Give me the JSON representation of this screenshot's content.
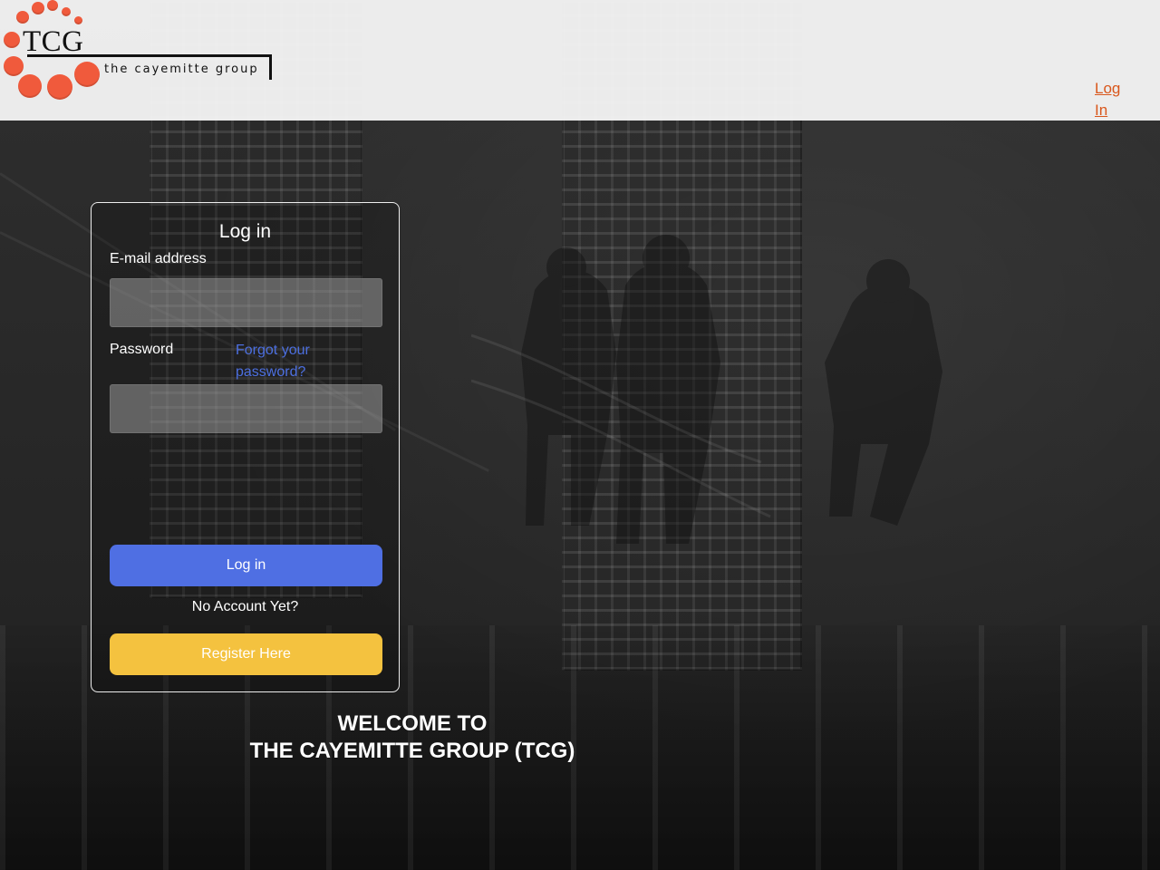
{
  "brand": {
    "logo_text": "TCG",
    "tagline": "the cayemitte group",
    "accent_color": "#f05a3c"
  },
  "header": {
    "login_link": "Log In",
    "login_link_color": "#d9571c"
  },
  "login_card": {
    "title": "Log in",
    "email_label": "E-mail address",
    "email_value": "",
    "password_label": "Password",
    "forgot_password": "Forgot your password?",
    "password_value": "",
    "login_button": "Log in",
    "no_account_text": "No Account Yet?",
    "register_button": "Register Here",
    "colors": {
      "primary_button": "#4f6fe3",
      "register_button": "#f4c23f",
      "link": "#4c6fe0"
    }
  },
  "welcome": {
    "line1": "WELCOME TO",
    "line2": "THE CAYEMITTE GROUP (TCG)"
  }
}
